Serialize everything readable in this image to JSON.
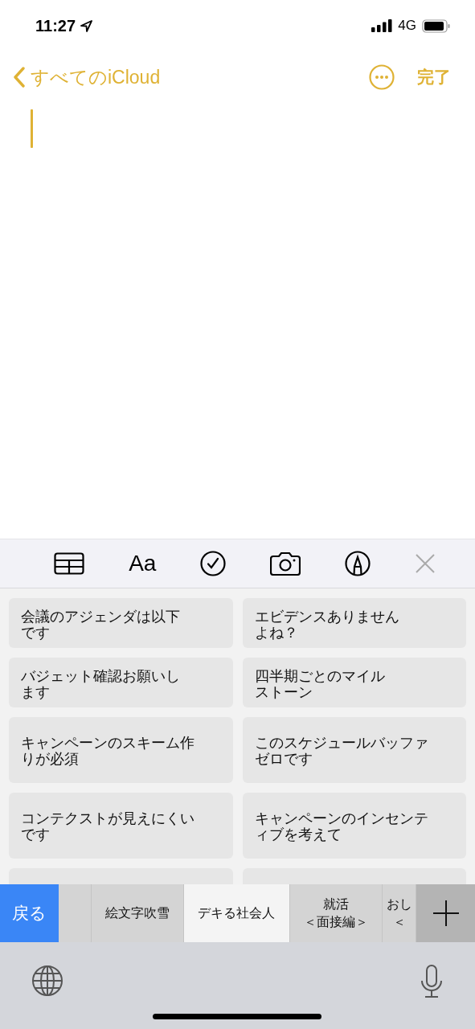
{
  "status_bar": {
    "time": "11:27",
    "network": "4G"
  },
  "nav": {
    "back_label": "すべてのiCloud",
    "done_label": "完了"
  },
  "toolbar": {
    "format_label": "Aa"
  },
  "phrases": [
    {
      "lines": [
        "会議のアジェンダは以下",
        "です"
      ]
    },
    {
      "lines": [
        "エビデンスありません",
        "よね？"
      ]
    },
    {
      "lines": [
        "バジェット確認お願いし",
        "ます"
      ]
    },
    {
      "lines": [
        "四半期ごとのマイル",
        "ストーン"
      ]
    },
    {
      "lines": [
        "キャンペーンのスキーム作",
        "りが必須"
      ]
    },
    {
      "lines": [
        "このスケジュールバッファ",
        "ゼロです"
      ]
    },
    {
      "lines": [
        "コンテクストが見えにくい",
        "です"
      ]
    },
    {
      "lines": [
        "キャンペーンのインセンテ",
        "ィブを考えて"
      ]
    }
  ],
  "back_key": "戻る",
  "categories": [
    {
      "lines": [
        "絵文字吹雪"
      ],
      "selected": false
    },
    {
      "lines": [
        "デキる社会人"
      ],
      "selected": true
    },
    {
      "lines": [
        "就活",
        "＜面接編＞"
      ],
      "selected": false
    },
    {
      "lines": [
        "おし",
        "＜"
      ],
      "selected": false
    }
  ]
}
